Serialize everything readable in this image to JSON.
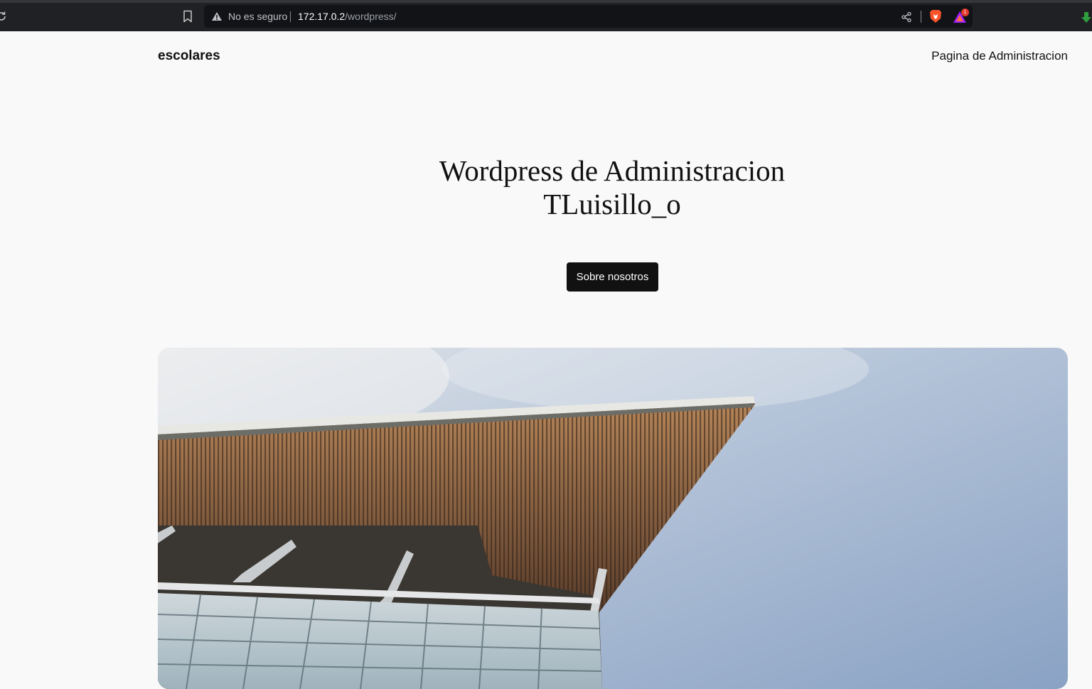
{
  "browser": {
    "security_label": "No es seguro",
    "url_host": "172.17.0.2",
    "url_path": "/wordpress/",
    "rewards_badge": "1",
    "icons": [
      "reload-icon",
      "bookmark-icon",
      "warning-icon",
      "share-icon",
      "brave-shield-icon",
      "brave-rewards-icon",
      "download-icon"
    ]
  },
  "header": {
    "site_title": "escolares",
    "nav_link": "Pagina de Administracion"
  },
  "hero": {
    "title_line1": "Wordpress de Administracion",
    "title_line2": "TLuisillo_o",
    "button_label": "Sobre nosotros"
  },
  "colors": {
    "page_bg": "#f9f9f9",
    "text": "#111111",
    "button_bg": "#111111",
    "chrome_bg": "#202124",
    "brave_orange": "#fb542b"
  }
}
